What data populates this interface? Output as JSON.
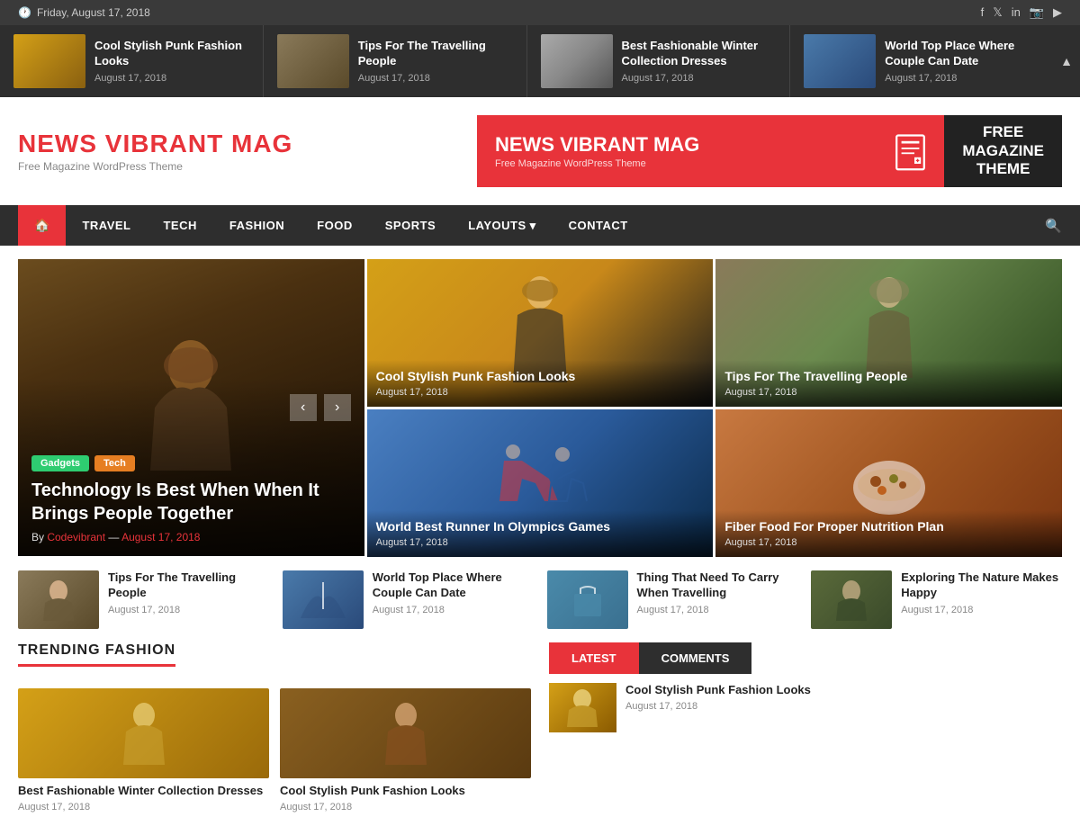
{
  "topbar": {
    "date": "Friday, August 17, 2018",
    "clock_icon": "🕐",
    "social": [
      "f",
      "t",
      "in",
      "📷",
      "▶"
    ]
  },
  "ticker": {
    "collapse_icon": "▲",
    "items": [
      {
        "title": "Cool Stylish Punk Fashion Looks",
        "date": "August 17, 2018",
        "img_class": "ti1"
      },
      {
        "title": "Tips For The Travelling People",
        "date": "August 17, 2018",
        "img_class": "ti2"
      },
      {
        "title": "Best Fashionable Winter Collection Dresses",
        "date": "August 17, 2018",
        "img_class": "ti3"
      },
      {
        "title": "World Top Place Where Couple Can Date",
        "date": "August 17, 2018",
        "img_class": "ti4"
      }
    ]
  },
  "header": {
    "logo_main": "NEWS VIBRANT ",
    "logo_accent": "MAG",
    "logo_sub": "Free Magazine WordPress Theme",
    "ad_title": "NEWS VIBRANT MAG",
    "ad_sub": "Free Magazine WordPress Theme",
    "ad_right": "FREE\nMAGAZINE\nTHEME"
  },
  "nav": {
    "home_icon": "🏠",
    "items": [
      "TRAVEL",
      "TECH",
      "FASHION",
      "FOOD",
      "SPORTS",
      "LAYOUTS ▾",
      "CONTACT"
    ],
    "search_icon": "🔍"
  },
  "featured": {
    "main": {
      "tags": [
        {
          "label": "Gadgets",
          "class": "tag-green"
        },
        {
          "label": "Tech",
          "class": "tag-orange"
        }
      ],
      "title": "Technology Is Best When When It Brings People Together",
      "author": "Codevibrant",
      "date": "August 17, 2018"
    },
    "side_top_left": {
      "title": "Cool Stylish Punk Fashion Looks",
      "date": "August 17, 2018"
    },
    "side_top_right": {
      "title": "Tips For The Travelling People",
      "date": "August 17, 2018"
    },
    "side_bottom_left": {
      "title": "World Best Runner In Olympics Games",
      "date": "August 17, 2018"
    },
    "side_bottom_right": {
      "title": "Fiber Food For Proper Nutrition Plan",
      "date": "August 17, 2018"
    }
  },
  "small_news": [
    {
      "title": "Tips For The Travelling People",
      "date": "August 17, 2018",
      "img_class": "st-travel"
    },
    {
      "title": "World Top Place Where Couple Can Date",
      "date": "August 17, 2018",
      "img_class": "st-couple"
    },
    {
      "title": "Thing That Need To Carry When Travelling",
      "date": "August 17, 2018",
      "img_class": "st-carry"
    },
    {
      "title": "Exploring The Nature Makes Happy",
      "date": "August 17, 2018",
      "img_class": "st-nature"
    }
  ],
  "trending": {
    "section_label": "TRENDING FASHION",
    "items": [
      {
        "title": "Best Fashionable Winter Collection Dresses",
        "date": "August 17, 2018",
        "img_class": "ti1"
      },
      {
        "title": "Cool Stylish Punk Fashion Looks",
        "date": "August 17, 2018",
        "img_class": "ti1"
      }
    ]
  },
  "latest": {
    "tab_latest": "LATEST",
    "tab_comments": "COMMENTS",
    "items": [
      {
        "title": "Cool Stylish Punk Fashion Looks",
        "date": "August 17, 2018",
        "img_class": "ti1"
      }
    ]
  }
}
